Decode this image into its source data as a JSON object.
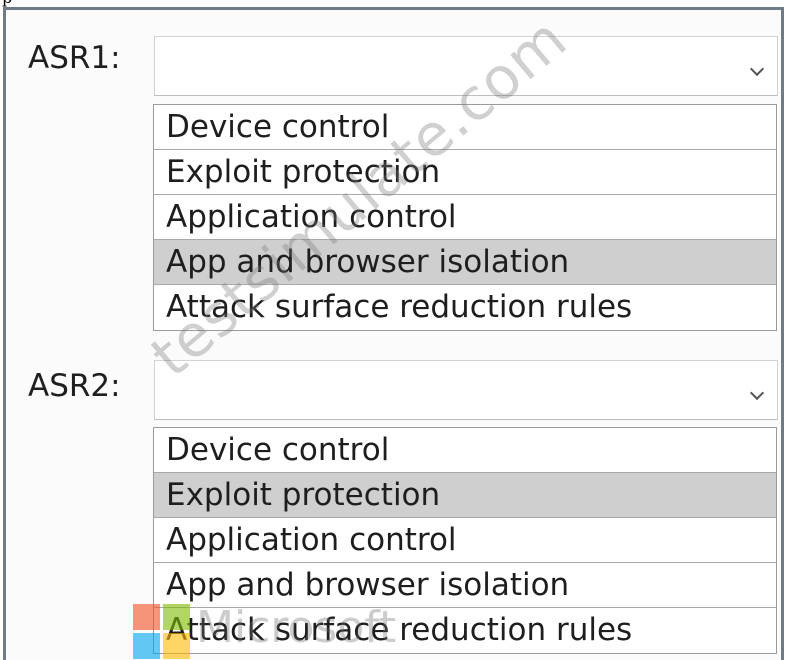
{
  "dropdowns": [
    {
      "label": "ASR1:",
      "selected_value": "",
      "options": [
        "Device control",
        "Exploit protection",
        "Application control",
        "App and browser isolation",
        "Attack surface reduction rules"
      ],
      "highlighted_option": "App and browser isolation"
    },
    {
      "label": "ASR2:",
      "selected_value": "",
      "options": [
        "Device control",
        "Exploit protection",
        "Application control",
        "App and browser isolation",
        "Attack surface reduction rules"
      ],
      "highlighted_option": "Exploit protection"
    }
  ],
  "watermark": {
    "text": "testsimulate.com",
    "logo_text": "Microsoft"
  },
  "icons": {
    "dropdown": "chevron-down-icon",
    "logo": "microsoft-logo-icon"
  },
  "colors": {
    "highlight": "#cfcfcf",
    "frame": "#6f7b86"
  }
}
